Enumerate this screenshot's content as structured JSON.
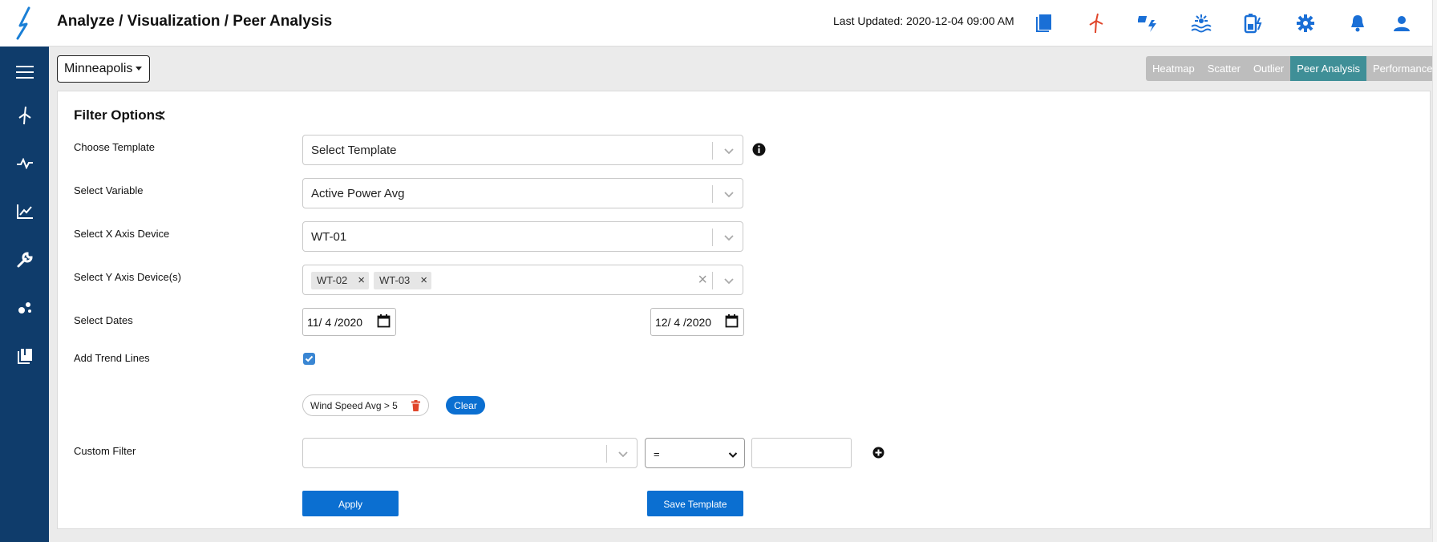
{
  "header": {
    "breadcrumb": "Analyze / Visualization / Peer Analysis",
    "last_updated": "Last Updated: 2020-12-04 09:00 AM",
    "icons": [
      "book-icon",
      "wind-turbine-icon",
      "solar-energy-icon",
      "hydro-icon",
      "battery-icon",
      "gear-icon",
      "bell-icon",
      "user-icon"
    ]
  },
  "sidebar": {
    "items": [
      "menu-icon",
      "wind-turbine-icon",
      "pulse-icon",
      "line-chart-icon",
      "wrench-icon",
      "scatter-icon",
      "library-icon"
    ]
  },
  "site_selector": {
    "value": "Minneapolis"
  },
  "tabs": [
    {
      "label": "Heatmap",
      "active": false
    },
    {
      "label": "Scatter",
      "active": false
    },
    {
      "label": "Outlier",
      "active": false
    },
    {
      "label": "Peer Analysis",
      "active": true
    },
    {
      "label": "Performance",
      "active": false
    }
  ],
  "filter": {
    "title": "Filter Options",
    "template_label": "Choose Template",
    "template_value": "Select Template",
    "variable_label": "Select Variable",
    "variable_value": "Active Power Avg",
    "x_device_label": "Select X Axis Device",
    "x_device_value": "WT-01",
    "y_devices_label": "Select Y Axis Device(s)",
    "y_devices": [
      "WT-02",
      "WT-03"
    ],
    "dates_label": "Select Dates",
    "date_start": "11/ 4 /2020",
    "date_end": "12/ 4 /2020",
    "trend_label": "Add Trend Lines",
    "trend_checked": true,
    "active_filter": "Wind Speed Avg > 5",
    "clear_label": "Clear",
    "custom_label": "Custom Filter",
    "operator_value": "=",
    "custom_value": "",
    "apply_label": "Apply",
    "save_label": "Save Template"
  },
  "colors": {
    "sidebar": "#0f3c6b",
    "primary": "#0b6fd1",
    "tab_active": "#3f8f97",
    "tab_inactive": "#bdbdbd",
    "icon_blue": "#1a6fd6",
    "icon_red": "#e0452a"
  }
}
